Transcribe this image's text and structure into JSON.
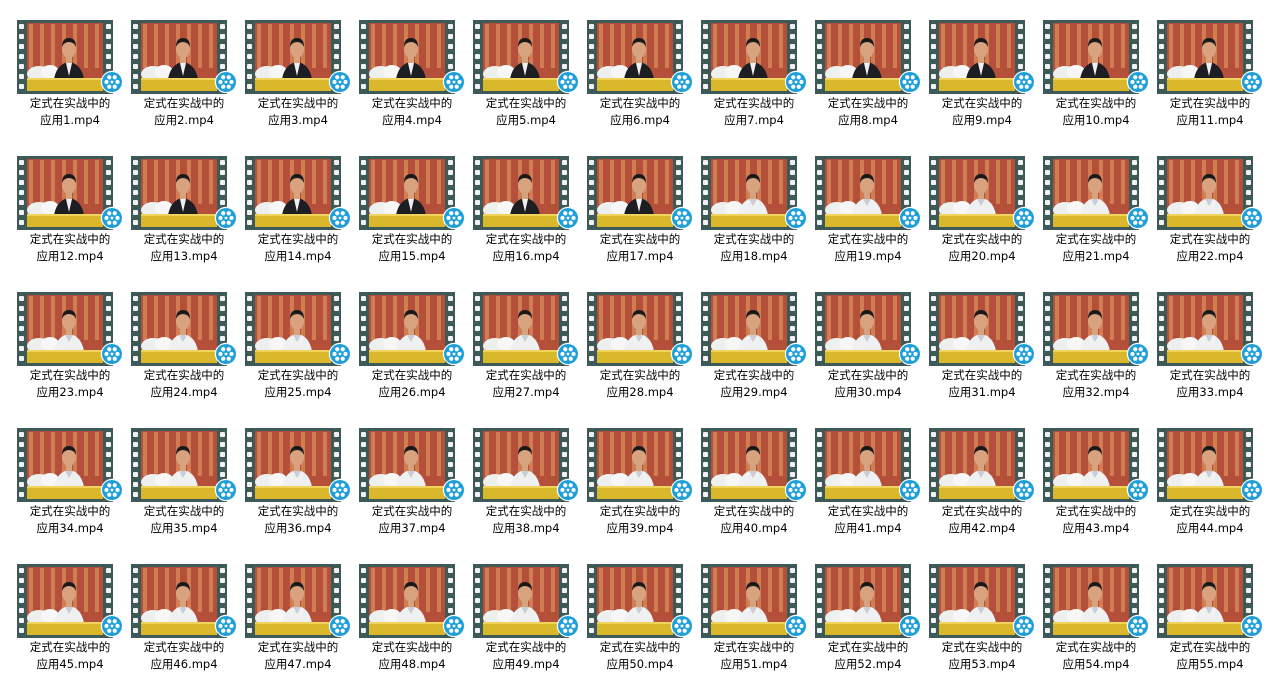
{
  "explorer": {
    "files": [
      {
        "name_line1": "定式在实战中的",
        "name_line2": "应用1.mp4",
        "variant": "dark"
      },
      {
        "name_line1": "定式在实战中的",
        "name_line2": "应用2.mp4",
        "variant": "dark"
      },
      {
        "name_line1": "定式在实战中的",
        "name_line2": "应用3.mp4",
        "variant": "dark"
      },
      {
        "name_line1": "定式在实战中的",
        "name_line2": "应用4.mp4",
        "variant": "dark"
      },
      {
        "name_line1": "定式在实战中的",
        "name_line2": "应用5.mp4",
        "variant": "dark"
      },
      {
        "name_line1": "定式在实战中的",
        "name_line2": "应用6.mp4",
        "variant": "dark"
      },
      {
        "name_line1": "定式在实战中的",
        "name_line2": "应用7.mp4",
        "variant": "dark"
      },
      {
        "name_line1": "定式在实战中的",
        "name_line2": "应用8.mp4",
        "variant": "dark"
      },
      {
        "name_line1": "定式在实战中的",
        "name_line2": "应用9.mp4",
        "variant": "dark"
      },
      {
        "name_line1": "定式在实战中的",
        "name_line2": "应用10.mp4",
        "variant": "dark"
      },
      {
        "name_line1": "定式在实战中的",
        "name_line2": "应用11.mp4",
        "variant": "dark"
      },
      {
        "name_line1": "定式在实战中的",
        "name_line2": "应用12.mp4",
        "variant": "dark"
      },
      {
        "name_line1": "定式在实战中的",
        "name_line2": "应用13.mp4",
        "variant": "dark"
      },
      {
        "name_line1": "定式在实战中的",
        "name_line2": "应用14.mp4",
        "variant": "dark"
      },
      {
        "name_line1": "定式在实战中的",
        "name_line2": "应用15.mp4",
        "variant": "dark"
      },
      {
        "name_line1": "定式在实战中的",
        "name_line2": "应用16.mp4",
        "variant": "dark"
      },
      {
        "name_line1": "定式在实战中的",
        "name_line2": "应用17.mp4",
        "variant": "dark"
      },
      {
        "name_line1": "定式在实战中的",
        "name_line2": "应用18.mp4",
        "variant": "white"
      },
      {
        "name_line1": "定式在实战中的",
        "name_line2": "应用19.mp4",
        "variant": "white"
      },
      {
        "name_line1": "定式在实战中的",
        "name_line2": "应用20.mp4",
        "variant": "white"
      },
      {
        "name_line1": "定式在实战中的",
        "name_line2": "应用21.mp4",
        "variant": "white"
      },
      {
        "name_line1": "定式在实战中的",
        "name_line2": "应用22.mp4",
        "variant": "white"
      },
      {
        "name_line1": "定式在实战中的",
        "name_line2": "应用23.mp4",
        "variant": "white"
      },
      {
        "name_line1": "定式在实战中的",
        "name_line2": "应用24.mp4",
        "variant": "white"
      },
      {
        "name_line1": "定式在实战中的",
        "name_line2": "应用25.mp4",
        "variant": "white"
      },
      {
        "name_line1": "定式在实战中的",
        "name_line2": "应用26.mp4",
        "variant": "white"
      },
      {
        "name_line1": "定式在实战中的",
        "name_line2": "应用27.mp4",
        "variant": "white"
      },
      {
        "name_line1": "定式在实战中的",
        "name_line2": "应用28.mp4",
        "variant": "white"
      },
      {
        "name_line1": "定式在实战中的",
        "name_line2": "应用29.mp4",
        "variant": "white"
      },
      {
        "name_line1": "定式在实战中的",
        "name_line2": "应用30.mp4",
        "variant": "white"
      },
      {
        "name_line1": "定式在实战中的",
        "name_line2": "应用31.mp4",
        "variant": "white"
      },
      {
        "name_line1": "定式在实战中的",
        "name_line2": "应用32.mp4",
        "variant": "white"
      },
      {
        "name_line1": "定式在实战中的",
        "name_line2": "应用33.mp4",
        "variant": "white"
      },
      {
        "name_line1": "定式在实战中的",
        "name_line2": "应用34.mp4",
        "variant": "white"
      },
      {
        "name_line1": "定式在实战中的",
        "name_line2": "应用35.mp4",
        "variant": "white"
      },
      {
        "name_line1": "定式在实战中的",
        "name_line2": "应用36.mp4",
        "variant": "white"
      },
      {
        "name_line1": "定式在实战中的",
        "name_line2": "应用37.mp4",
        "variant": "white"
      },
      {
        "name_line1": "定式在实战中的",
        "name_line2": "应用38.mp4",
        "variant": "white"
      },
      {
        "name_line1": "定式在实战中的",
        "name_line2": "应用39.mp4",
        "variant": "white"
      },
      {
        "name_line1": "定式在实战中的",
        "name_line2": "应用40.mp4",
        "variant": "white"
      },
      {
        "name_line1": "定式在实战中的",
        "name_line2": "应用41.mp4",
        "variant": "white"
      },
      {
        "name_line1": "定式在实战中的",
        "name_line2": "应用42.mp4",
        "variant": "white"
      },
      {
        "name_line1": "定式在实战中的",
        "name_line2": "应用43.mp4",
        "variant": "white"
      },
      {
        "name_line1": "定式在实战中的",
        "name_line2": "应用44.mp4",
        "variant": "white"
      },
      {
        "name_line1": "定式在实战中的",
        "name_line2": "应用45.mp4",
        "variant": "white"
      },
      {
        "name_line1": "定式在实战中的",
        "name_line2": "应用46.mp4",
        "variant": "white"
      },
      {
        "name_line1": "定式在实战中的",
        "name_line2": "应用47.mp4",
        "variant": "white"
      },
      {
        "name_line1": "定式在实战中的",
        "name_line2": "应用48.mp4",
        "variant": "white"
      },
      {
        "name_line1": "定式在实战中的",
        "name_line2": "应用49.mp4",
        "variant": "white"
      },
      {
        "name_line1": "定式在实战中的",
        "name_line2": "应用50.mp4",
        "variant": "white"
      },
      {
        "name_line1": "定式在实战中的",
        "name_line2": "应用51.mp4",
        "variant": "white"
      },
      {
        "name_line1": "定式在实战中的",
        "name_line2": "应用52.mp4",
        "variant": "white"
      },
      {
        "name_line1": "定式在实战中的",
        "name_line2": "应用53.mp4",
        "variant": "white"
      },
      {
        "name_line1": "定式在实战中的",
        "name_line2": "应用54.mp4",
        "variant": "white"
      },
      {
        "name_line1": "定式在实战中的",
        "name_line2": "应用55.mp4",
        "variant": "white"
      }
    ]
  },
  "icons": {
    "thumbnail": "video-thumbnail-icon",
    "film_strip": "film-strip-icon",
    "media_badge": "film-reel-icon"
  },
  "colors": {
    "film": "#3e5a58",
    "film_hole": "#f2f2f2",
    "backdrop_red": "#b4503a",
    "backdrop_stripe": "#d98c5e",
    "desk_yellow": "#d9b72a",
    "dark_suit": "#1e1e22",
    "white_shirt": "#eef0f2",
    "skin": "#d9a27f",
    "hair": "#1a1a1a",
    "badge_blue": "#1e9fdc",
    "badge_ring": "#ffffff"
  }
}
